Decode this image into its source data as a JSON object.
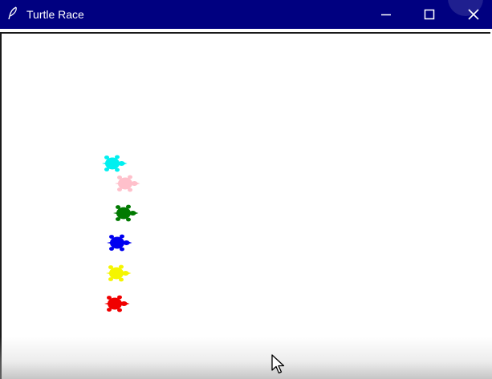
{
  "window": {
    "title": "Turtle Race",
    "icon": "feather-icon",
    "controls": [
      "minimize-icon",
      "maximize-icon",
      "close-icon"
    ]
  },
  "canvas": {
    "background": "#ffffff",
    "turtles": [
      {
        "name": "cyan",
        "color": "#00f0f0"
      },
      {
        "name": "pink",
        "color": "#ffc0cb"
      },
      {
        "name": "green",
        "color": "#007a00"
      },
      {
        "name": "blue",
        "color": "#0000f0"
      },
      {
        "name": "yellow",
        "color": "#f5f500"
      },
      {
        "name": "red",
        "color": "#f00000"
      }
    ]
  },
  "cursor": "arrow-cursor-icon"
}
